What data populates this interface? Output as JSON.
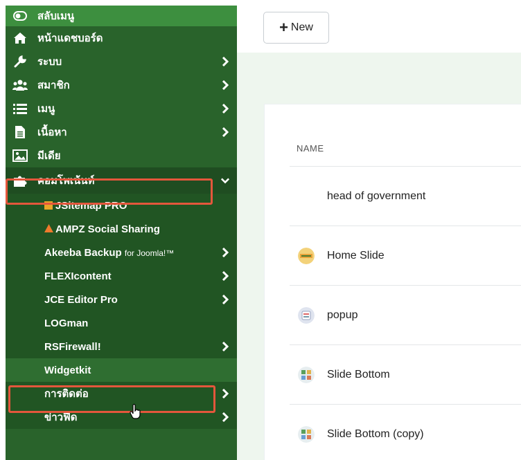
{
  "sidebar": {
    "toggle_label": "สลับเมนู",
    "dashboard_label": "หน้าแดชบอร์ด",
    "system_label": "ระบบ",
    "members_label": "สมาชิก",
    "menus_label": "เมนู",
    "content_label": "เนื้อหา",
    "media_label": "มีเดีย",
    "components_label": "คอมโพเน้นท์",
    "components": [
      {
        "label": "JSitemap PRO"
      },
      {
        "label": "AMPZ Social Sharing"
      },
      {
        "label": "Akeeba Backup",
        "suffix": "for Joomla!™"
      },
      {
        "label": "FLEXIcontent"
      },
      {
        "label": "JCE Editor Pro"
      },
      {
        "label": "LOGman"
      },
      {
        "label": "RSFirewall!"
      },
      {
        "label": "Widgetkit"
      },
      {
        "label": "การติดต่อ"
      },
      {
        "label": "ข่าวฟีด"
      }
    ]
  },
  "toolbar": {
    "new_label": "New"
  },
  "table": {
    "column_name": "NAME",
    "rows": [
      {
        "name": "head of government"
      },
      {
        "name": "Home Slide"
      },
      {
        "name": "popup"
      },
      {
        "name": "Slide Bottom"
      },
      {
        "name": "Slide Bottom (copy)"
      }
    ]
  },
  "colors": {
    "sidebar_bg": "#29632b",
    "highlight": "#e4573c",
    "content_bg": "#eef6ee"
  }
}
